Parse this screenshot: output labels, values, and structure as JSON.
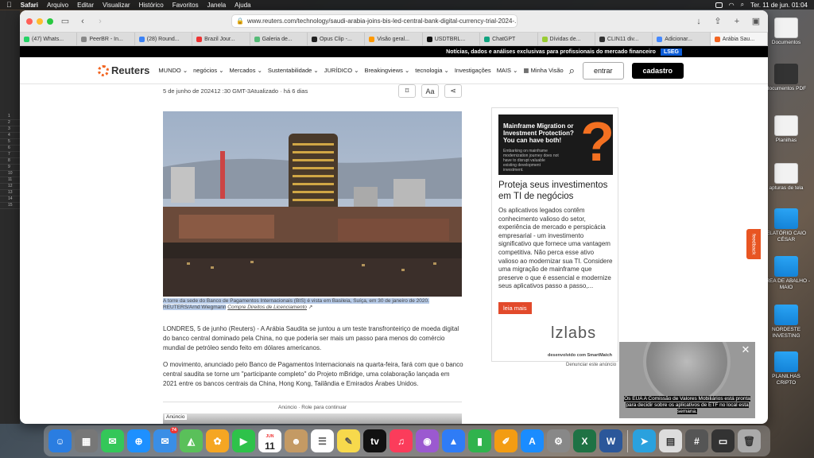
{
  "menubar": {
    "app": "Safari",
    "items": [
      "Arquivo",
      "Editar",
      "Visualizar",
      "Histórico",
      "Favoritos",
      "Janela",
      "Ajuda"
    ],
    "clock": "Ter. 11 de jun.  01:04"
  },
  "browser": {
    "url": "www.reuters.com/technology/saudi-arabia-joins-bis-led-central-bank-digital-currency-trial-2024-...",
    "tabs": [
      "(47) Whats...",
      "PeerBR - In...",
      "(28) Round...",
      "Brazil Jour...",
      "Galeria de...",
      "Opus Clip -...",
      "Visão geral...",
      "USDTBRL...",
      "ChatGPT",
      "Dívidas de...",
      "CLIN11 div...",
      "Adicionar...",
      "Arábia Sau..."
    ]
  },
  "promo": {
    "text": "Notícias, dados e análises exclusivas para profissionais do mercado financeiro",
    "badge": "LSEG"
  },
  "header": {
    "logo": "Reuters",
    "nav": [
      "MUNDO",
      "negócios",
      "Mercados",
      "Sustentabilidade",
      "JURÍDICO",
      "Breakingviews",
      "tecnologia",
      "Investigações",
      "MAIS"
    ],
    "minha_visao": "Minha Visão",
    "login": "entrar",
    "signup": "cadastro"
  },
  "article": {
    "dateline": "5 de junho de 202412 :30 GMT-3Atualizado · há 6 dias",
    "caption_highlight": "A torre da sede do Banco de Pagamentos Internacionais (BIS) é vista em Basileia, Suíça, em 30 de janeiro de 2020. REUTERS/Arnd Wiegmann",
    "caption_link": "Compre Direitos de Licenciamento",
    "p1": "LONDRES, 5 de junho (Reuters) - A Arábia Saudita se juntou a um teste transfronteiriço de moeda digital do banco central dominado pela China, no que poderia ser mais um passo para menos do comércio mundial de petróleo sendo feito em dólares americanos.",
    "p2": "O movimento, anunciado pelo Banco de Pagamentos Internacionais na quarta-feira, fará com que o banco central saudita se torne um \"participante completo\" do Projeto mBridge, uma colaboração lançada em 2021 entre os bancos centrais da China, Hong Kong, Tailândia e Emirados Árabes Unidos.",
    "ad_label": "Anúncio · Role para continuar",
    "ad_tag": "Anúncio",
    "tools": {
      "font": "Aa"
    }
  },
  "sidead": {
    "img_title": "Mainframe Migration or Investment Protection? You can have both!",
    "img_text": "Embarking on mainframe modernization journey does not have to disrupt valuable existing development investment.",
    "title": "Proteja seus investimentos em TI de negócios",
    "body": "Os aplicativos legados contêm conhecimento valioso do setor, experiência de mercado e perspicácia empresarial - um investimento significativo que fornece uma vantagem competitiva. Não perca esse ativo valioso ao modernizar sua TI. Considere uma migração de mainframe que preserve o que é essencial e modernize seus aplicativos passo a passo,...",
    "button": "leia mais",
    "logo": "lzlabs",
    "dev": "desenvolvido com SmartMatch",
    "report": "Denunciar este anúncio"
  },
  "feedback": "feedback",
  "popup": {
    "caption": "Os EUA A Comissão de Valores Mobiliários está pronta para decidir sobre os aplicativos de ETF no local esta semana."
  },
  "desktop": [
    "Documentos",
    "documentos PDF",
    "Planilhas",
    "apturas de tela",
    "ELATÓRIO CAIO CÉSAR",
    "ÁREA DE ABALHO - MAIO",
    "NORDESTE INVESTING",
    "PLANILHAS CRIPTO"
  ],
  "dock": {
    "mail_badge": "74",
    "calendar_month": "JUN",
    "calendar_day": "11"
  }
}
